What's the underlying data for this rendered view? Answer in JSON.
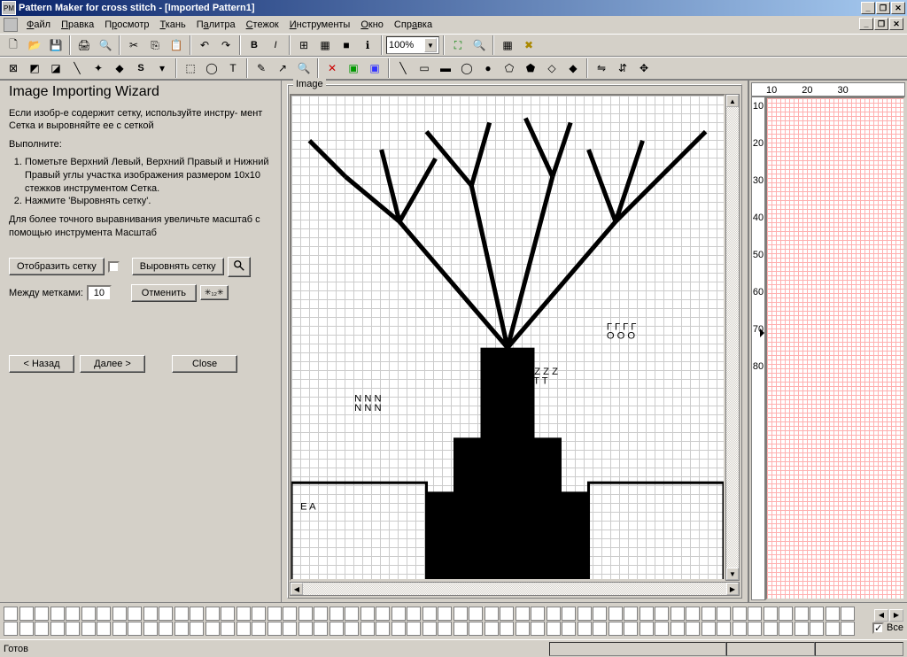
{
  "titlebar": {
    "text": "Pattern Maker for cross stitch - [Imported Pattern1]"
  },
  "menu": {
    "items": [
      "Файл",
      "Правка",
      "Просмотр",
      "Ткань",
      "Палитра",
      "Стежок",
      "Инструменты",
      "Окно",
      "Справка"
    ]
  },
  "toolbar": {
    "zoom_value": "100%"
  },
  "wizard": {
    "title": "Image Importing Wizard",
    "intro": "Если изобр-е содержит сетку, используйте инстру- мент Сетка и выровняйте ее с сеткой",
    "do_label": "Выполните:",
    "step1": "Пометьте Верхний Левый, Верхний Правый и Нижний Правый углы участка изображения размером 10x10 стежков инструментом Сетка.",
    "step2": "Нажмите 'Выровнять сетку'.",
    "hint": "Для более точного выравнивания увеличьте масштаб с помощью инструмента Масштаб",
    "show_grid_btn": "Отобразить сетку",
    "align_grid_btn": "Выровнять сетку",
    "between_marks_label": "Между метками:",
    "between_marks_value": "10",
    "cancel_btn": "Отменить",
    "back_btn": "< Назад",
    "next_btn": "Далее >",
    "close_btn": "Close"
  },
  "image_panel": {
    "legend": "Image"
  },
  "preview": {
    "h_ticks": [
      "10",
      "20",
      "30"
    ],
    "v_ticks": [
      "10",
      "20",
      "30",
      "40",
      "50",
      "60",
      "70",
      "80"
    ]
  },
  "palette_side": {
    "all_label": "Все"
  },
  "status": {
    "text": "Готов"
  }
}
